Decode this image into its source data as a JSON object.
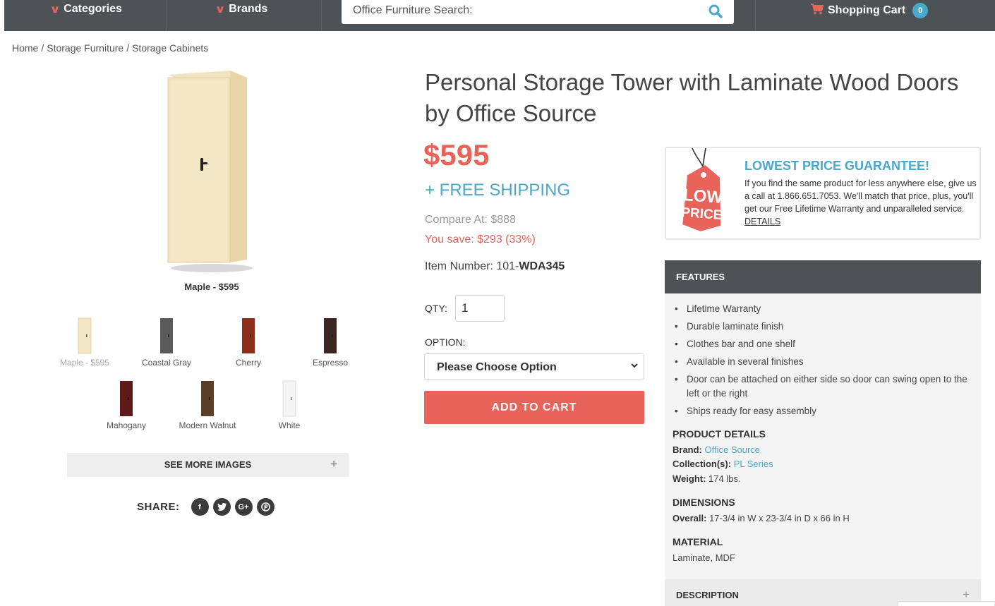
{
  "nav": {
    "categories": "Categories",
    "brands": "Brands",
    "search_placeholder": "Office Furniture Search:",
    "cart_label": "Shopping Cart",
    "cart_count": "0"
  },
  "breadcrumb": [
    "Home",
    "Storage Furniture",
    "Storage Cabinets"
  ],
  "gallery": {
    "main_caption": "Maple - $595",
    "swatches": [
      {
        "label": "Maple - $595",
        "color": "#f3e7c5"
      },
      {
        "label": "Coastal Gray",
        "color": "#5a5a5a"
      },
      {
        "label": "Cherry",
        "color": "#8b2f1c"
      },
      {
        "label": "Espresso",
        "color": "#3b2621"
      },
      {
        "label": "Mahogany",
        "color": "#5e1a16"
      },
      {
        "label": "Modern Walnut",
        "color": "#5a3e27"
      },
      {
        "label": "White",
        "color": "#f2f2f2"
      }
    ],
    "see_more": "SEE MORE IMAGES",
    "share_label": "SHARE:",
    "social": [
      "facebook-icon",
      "twitter-icon",
      "google-plus-icon",
      "pinterest-icon"
    ]
  },
  "product": {
    "title": "Personal Storage Tower with Laminate Wood Doors by Office Source",
    "price": "$595",
    "shipping": "+ FREE SHIPPING",
    "compare_at": "Compare At: $888",
    "you_save": "You save: $293 (33%)",
    "item_number_label": "Item Number: 101-",
    "item_number": "WDA345",
    "qty_label": "QTY:",
    "qty_value": "1",
    "option_label": "OPTION:",
    "option_selected": "Please Choose Option",
    "add_to_cart": "ADD TO CART"
  },
  "guarantee": {
    "tag_line1": "LOW",
    "tag_line2": "PRICE",
    "title": "LOWEST PRICE GUARANTEE!",
    "body": "If you find the same product for less anywhere else, give us a call at 1.866.651.7053. We'll match that price, plus, you'll get our Free Lifetime Warranty and unparalleled service.",
    "details_link": "DETAILS"
  },
  "features": {
    "heading": "FEATURES",
    "items": [
      "Lifetime Warranty",
      "Durable laminate finish",
      "Clothes bar and one shelf",
      "Available in several finishes",
      "Door can be attached on either side so door can swing open to the left or the right",
      "Ships ready for easy assembly"
    ],
    "product_details_heading": "PRODUCT DETAILS",
    "brand_label": "Brand:",
    "brand_value": "Office Source",
    "collection_label": "Collection(s):",
    "collection_value": "PL Series",
    "weight_label": "Weight:",
    "weight_value": "174 lbs.",
    "dimensions_heading": "DIMENSIONS",
    "overall_label": "Overall:",
    "overall_value": "17-3/4 in W x 23-3/4 in D x 66 in H",
    "material_heading": "MATERIAL",
    "material_value": "Laminate, MDF",
    "description_label": "DESCRIPTION"
  },
  "colors": {
    "accent": "#e8635a",
    "link": "#4aa9c9",
    "nav_bg": "#4d5256"
  }
}
